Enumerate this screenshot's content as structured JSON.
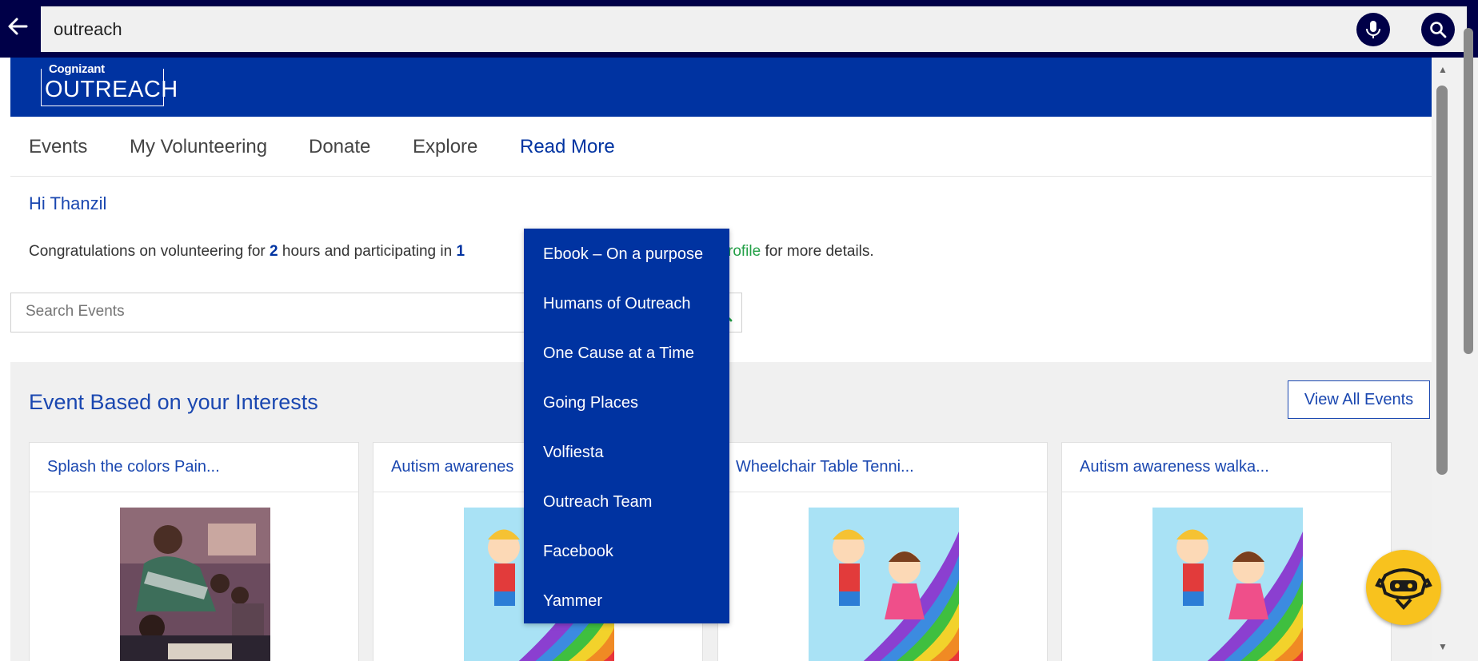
{
  "browser": {
    "back_icon": "arrow-left-icon",
    "query": "outreach",
    "mic_icon": "microphone-icon",
    "search_icon": "search-icon"
  },
  "brand": {
    "logo_top": "Cognizant",
    "logo_main": "OUTREACH",
    "color": "#0033a1"
  },
  "nav": {
    "items": [
      {
        "label": "Events"
      },
      {
        "label": "My Volunteering"
      },
      {
        "label": "Donate"
      },
      {
        "label": "Explore"
      },
      {
        "label": "Read More"
      }
    ],
    "active": "Read More"
  },
  "greeting": "Hi Thanzil",
  "congrats": {
    "part1": "Congratulations on volunteering for ",
    "hours": "2",
    "part2": " hours and participating in ",
    "events": "1",
    "link": "teering profile",
    "part3": " for more details."
  },
  "event_search": {
    "placeholder": "Search Events",
    "icon": "search-icon"
  },
  "interests": {
    "title": "Event Based on your Interests",
    "view_all": "View All Events",
    "cards": [
      {
        "title": "Splash the colors Pain...",
        "image": "classroom-photo"
      },
      {
        "title": "Autism awarenes",
        "image": "kids-rainbow-illustration"
      },
      {
        "title": "Wheelchair Table Tenni...",
        "image": "kids-rainbow-illustration"
      },
      {
        "title": "Autism awareness walka...",
        "image": "kids-rainbow-illustration"
      }
    ]
  },
  "read_more_menu": [
    "Ebook – On a purpose",
    "Humans of Outreach",
    "One Cause at a Time",
    "Going Places",
    "Volfiesta",
    "Outreach Team",
    "Facebook",
    "Yammer"
  ],
  "chatbot_icon": "chatbot-icon"
}
